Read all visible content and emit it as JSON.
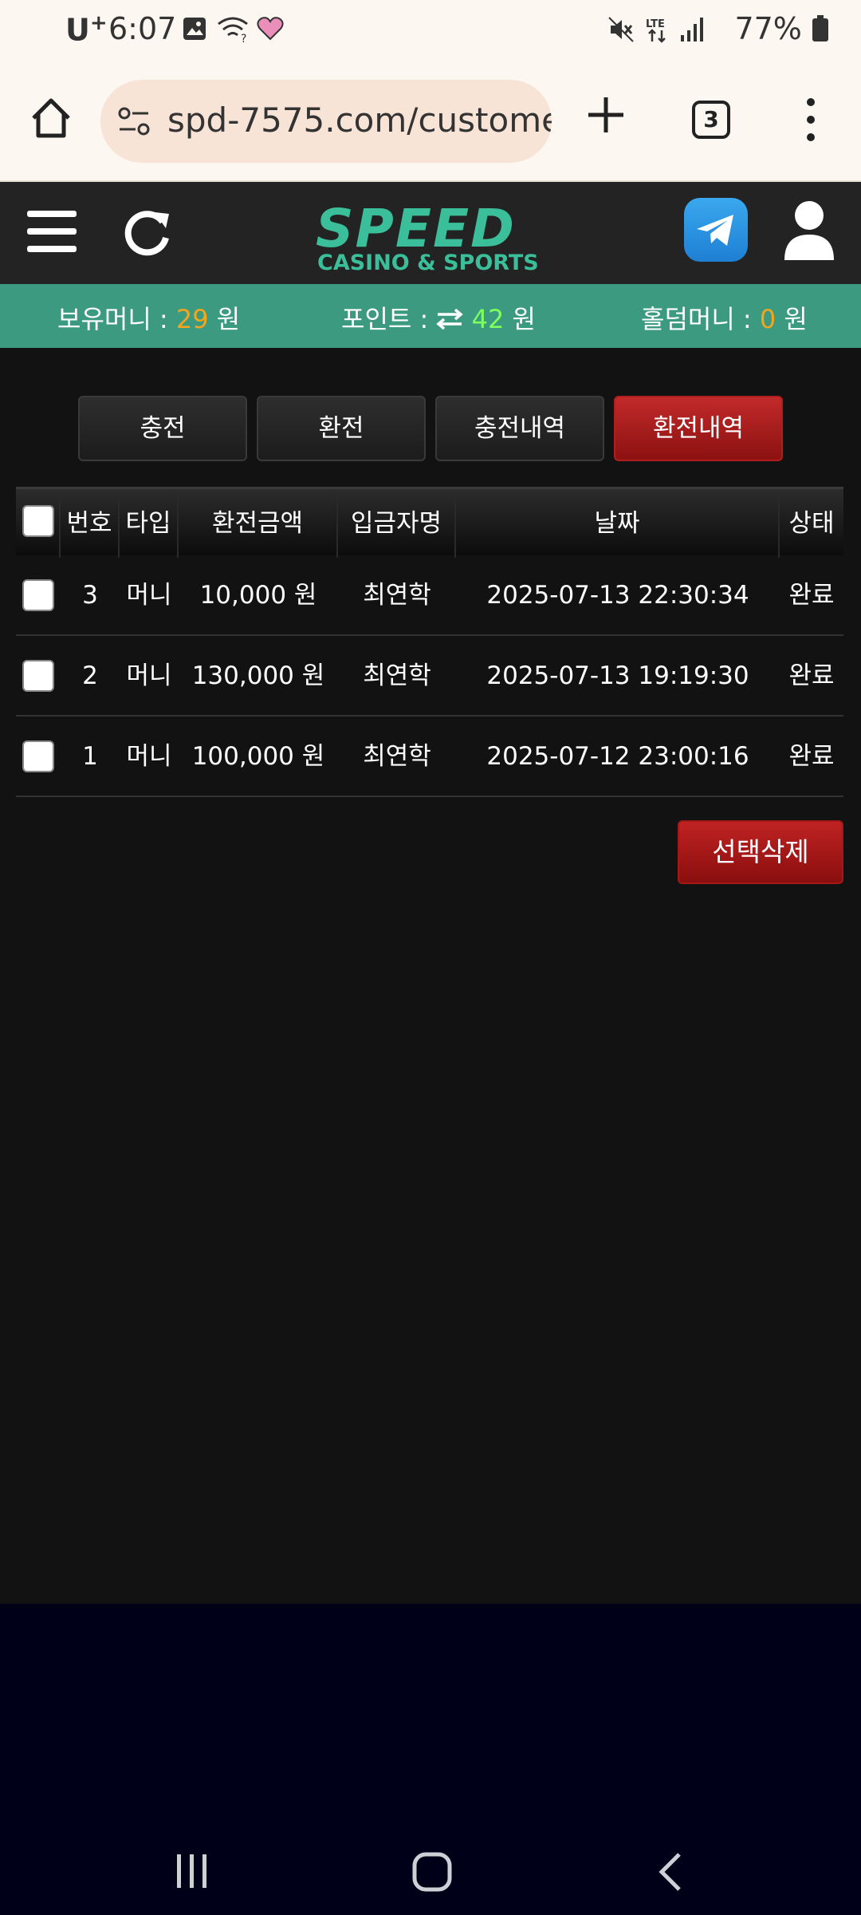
{
  "status_bar": {
    "carrier": "U",
    "carrier_sup": "+",
    "time": "6:07",
    "battery": "77%"
  },
  "browser": {
    "url": "spd-7575.com/custome",
    "tab_count": "3"
  },
  "header": {
    "logo_main": "SPEED",
    "logo_sub": "CASINO & SPORTS"
  },
  "balances": {
    "holding_label": "보유머니 : ",
    "holding_value": "29",
    "point_label": "포인트 : ",
    "point_value": "42",
    "holdem_label": "홀덤머니 : ",
    "holdem_value": "0",
    "unit": " 원"
  },
  "tabs": [
    {
      "label": "충전"
    },
    {
      "label": "환전"
    },
    {
      "label": "충전내역"
    },
    {
      "label": "환전내역"
    }
  ],
  "table": {
    "headers": {
      "no": "번호",
      "type": "타입",
      "amount": "환전금액",
      "depositor": "입금자명",
      "date": "날짜",
      "status": "상태"
    },
    "rows": [
      {
        "no": "3",
        "type": "머니",
        "amount": "10,000 원",
        "depositor": "최연학",
        "date": "2025-07-13 22:30:34",
        "status": "완료"
      },
      {
        "no": "2",
        "type": "머니",
        "amount": "130,000 원",
        "depositor": "최연학",
        "date": "2025-07-13 19:19:30",
        "status": "완료"
      },
      {
        "no": "1",
        "type": "머니",
        "amount": "100,000 원",
        "depositor": "최연학",
        "date": "2025-07-12 23:00:16",
        "status": "완료"
      }
    ]
  },
  "delete_button": "선택삭제",
  "colors": {
    "accent_green": "#3b9a80",
    "active_red": "#b01e1e",
    "balance_orange": "#f3a51e",
    "point_green": "#7dff5d"
  },
  "icons": [
    "image-icon",
    "wifi-icon",
    "heart-icon",
    "mute-icon",
    "lte-icon",
    "signal-icon",
    "battery-icon",
    "home-icon",
    "site-settings-icon",
    "plus-icon",
    "more-icon",
    "hamburger-icon",
    "refresh-icon",
    "telegram-icon",
    "user-icon",
    "transfer-icon",
    "recents-icon",
    "nav-home-icon",
    "back-icon"
  ]
}
